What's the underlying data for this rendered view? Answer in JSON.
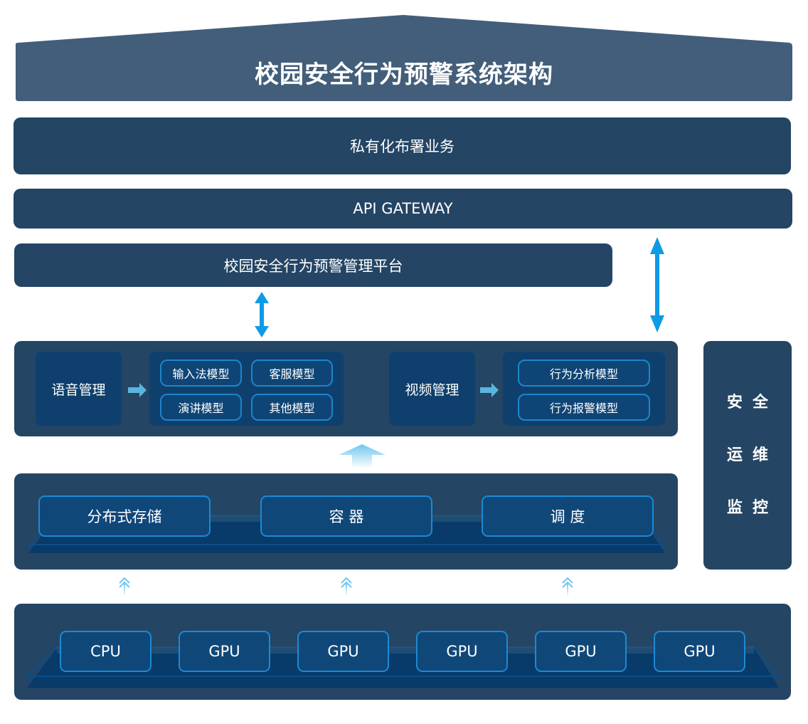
{
  "title": "校园安全行为预警系统架构",
  "layers": {
    "private_deploy": "私有化布署业务",
    "api_gateway": "API GATEWAY",
    "platform": "校园安全行为预警管理平台"
  },
  "service_layer": {
    "voice": {
      "label": "语音管理",
      "models": [
        "输入法模型",
        "客服模型",
        "演讲模型",
        "其他模型"
      ]
    },
    "video": {
      "label": "视频管理",
      "models": [
        "行为分析模型",
        "行为报警模型"
      ]
    }
  },
  "infra_layer": {
    "items": [
      "分布式存储",
      "容 器",
      "调 度"
    ]
  },
  "hardware_layer": {
    "items": [
      "CPU",
      "GPU",
      "GPU",
      "GPU",
      "GPU",
      "GPU"
    ]
  },
  "side_panel": {
    "lines": [
      "安全",
      "运维",
      "监控"
    ]
  },
  "colors": {
    "roof": "#425e7a",
    "panel": "#244564",
    "sub_panel": "#0f406d",
    "chip_border": "#1b86cc",
    "arrow": "#0d9be6",
    "light_arrow": "#6fc6ef"
  }
}
